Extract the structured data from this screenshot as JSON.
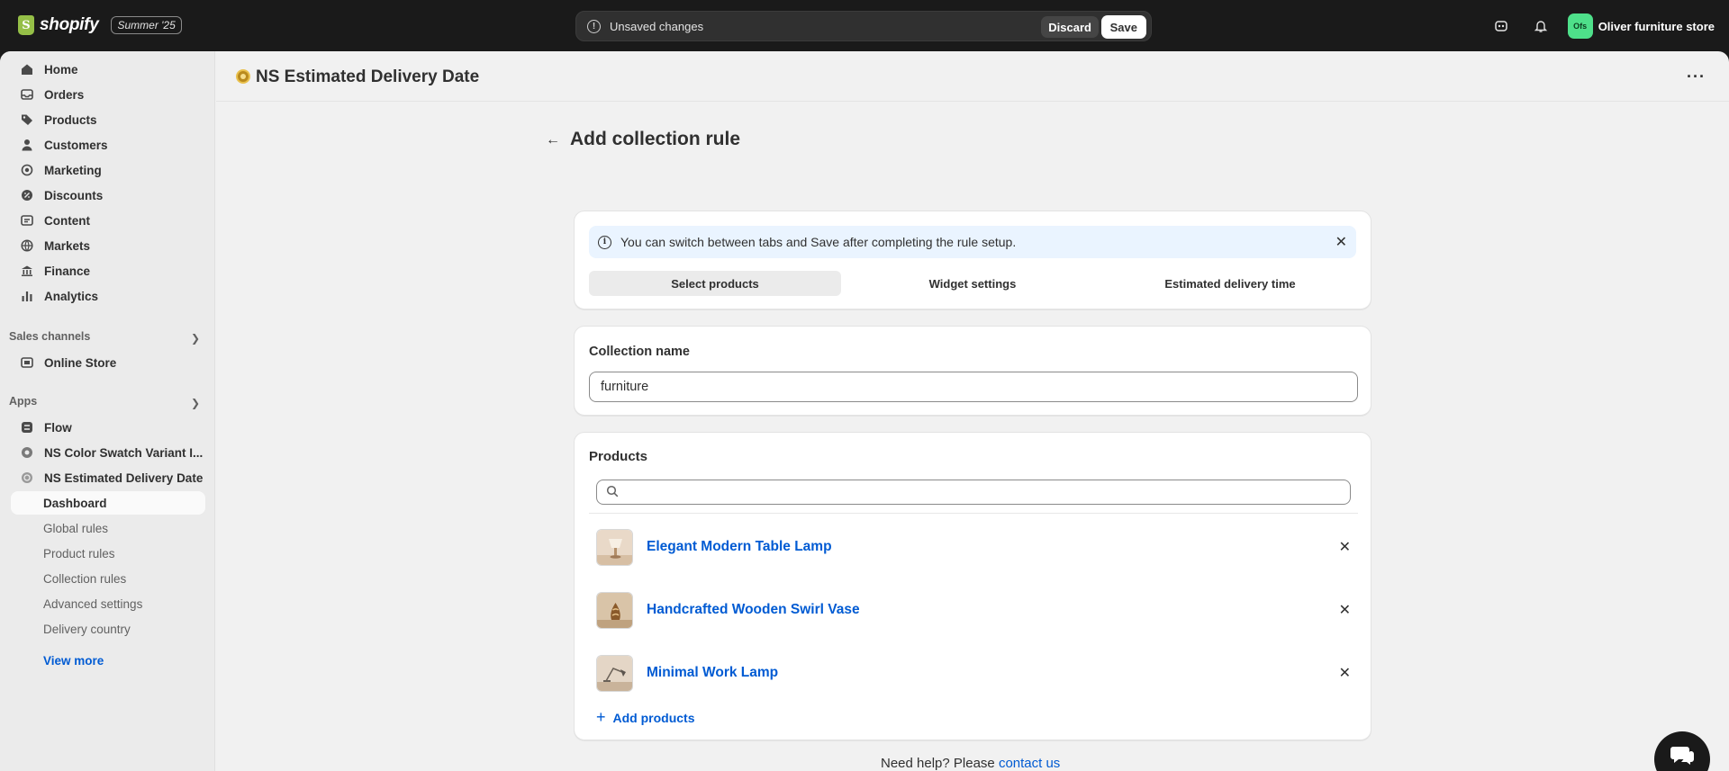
{
  "topbar": {
    "brand": "shopify",
    "season_badge": "Summer '25",
    "unsaved_text": "Unsaved changes",
    "discard_label": "Discard",
    "save_label": "Save",
    "store_initials": "Ofs",
    "store_name": "Oliver furniture store"
  },
  "sidebar": {
    "items": [
      {
        "label": "Home",
        "icon": "home-icon"
      },
      {
        "label": "Orders",
        "icon": "orders-icon"
      },
      {
        "label": "Products",
        "icon": "tag-icon"
      },
      {
        "label": "Customers",
        "icon": "person-icon"
      },
      {
        "label": "Marketing",
        "icon": "target-icon"
      },
      {
        "label": "Discounts",
        "icon": "discount-icon"
      },
      {
        "label": "Content",
        "icon": "content-icon"
      },
      {
        "label": "Markets",
        "icon": "globe-icon"
      },
      {
        "label": "Finance",
        "icon": "bank-icon"
      },
      {
        "label": "Analytics",
        "icon": "bar-chart-icon"
      }
    ],
    "sales_channels_label": "Sales channels",
    "online_store": "Online Store",
    "apps_label": "Apps",
    "apps": [
      {
        "label": "Flow"
      },
      {
        "label": "NS Color Swatch Variant I..."
      },
      {
        "label": "NS Estimated Delivery Date"
      }
    ],
    "sub_items": [
      {
        "label": "Dashboard"
      },
      {
        "label": "Global rules"
      },
      {
        "label": "Product rules"
      },
      {
        "label": "Collection rules"
      },
      {
        "label": "Advanced settings"
      },
      {
        "label": "Delivery country"
      }
    ],
    "view_more": "View more"
  },
  "app_header": {
    "title": "NS Estimated Delivery Date"
  },
  "page": {
    "title": "Add collection rule",
    "banner_text": "You can switch between tabs and Save after completing the rule setup.",
    "tabs": [
      {
        "label": "Select products",
        "active": true
      },
      {
        "label": "Widget settings",
        "active": false
      },
      {
        "label": "Estimated delivery time",
        "active": false
      }
    ],
    "collection_label": "Collection name",
    "collection_value": "furniture",
    "products_title": "Products",
    "search_placeholder": "",
    "products": [
      {
        "name": "Elegant Modern Table Lamp"
      },
      {
        "name": "Handcrafted Wooden Swirl Vase"
      },
      {
        "name": "Minimal Work Lamp"
      }
    ],
    "add_products": "Add products",
    "help_text": "Need help? Please ",
    "help_link": "contact us"
  },
  "colors": {
    "accent_link": "#005bd3",
    "topbar_bg": "#1a1a1a",
    "banner_bg": "#eaf4ff",
    "store_avatar": "#4ee08a"
  }
}
